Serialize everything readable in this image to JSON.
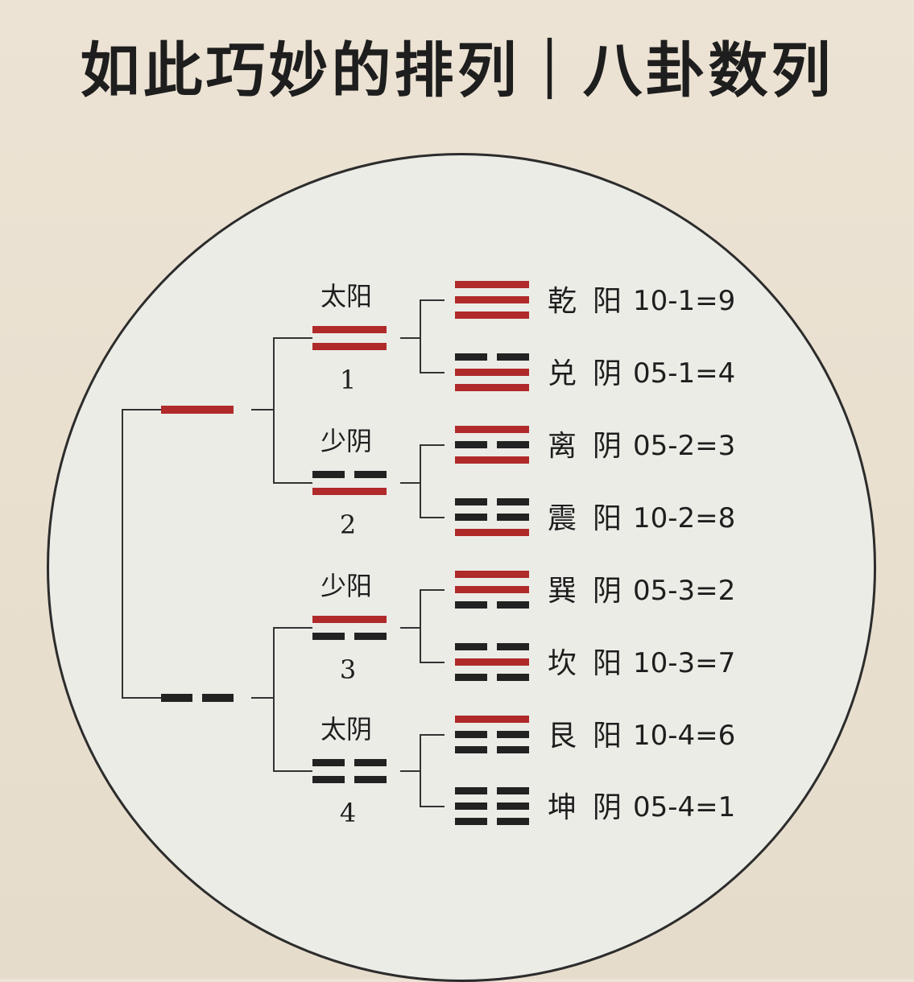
{
  "title": "如此巧妙的排列｜八卦数列",
  "colors": {
    "yang": "#b02a2a",
    "yin": "#222222",
    "bracket": "#333333"
  },
  "level1": [
    {
      "line": "yang"
    },
    {
      "line": "yin"
    }
  ],
  "level2": [
    {
      "name": "太阳",
      "num": "1",
      "lines": [
        "yang",
        "yang"
      ]
    },
    {
      "name": "少阴",
      "num": "2",
      "lines": [
        "yin",
        "yang"
      ]
    },
    {
      "name": "少阳",
      "num": "3",
      "lines": [
        "yang",
        "yin"
      ]
    },
    {
      "name": "太阴",
      "num": "4",
      "lines": [
        "yin",
        "yin"
      ]
    }
  ],
  "level3": [
    {
      "name": "乾",
      "polarity": "阳",
      "polarity_type": "yang",
      "formula": "10-1=9",
      "lines": [
        "yang",
        "yang",
        "yang"
      ]
    },
    {
      "name": "兑",
      "polarity": "阴",
      "polarity_type": "yin",
      "formula": "05-1=4",
      "lines": [
        "yin",
        "yang",
        "yang"
      ]
    },
    {
      "name": "离",
      "polarity": "阴",
      "polarity_type": "yin",
      "formula": "05-2=3",
      "lines": [
        "yang",
        "yin",
        "yang"
      ]
    },
    {
      "name": "震",
      "polarity": "阳",
      "polarity_type": "yang",
      "formula": "10-2=8",
      "lines": [
        "yin",
        "yin",
        "yang"
      ]
    },
    {
      "name": "巽",
      "polarity": "阴",
      "polarity_type": "yin",
      "formula": "05-3=2",
      "lines": [
        "yang",
        "yang",
        "yin"
      ]
    },
    {
      "name": "坎",
      "polarity": "阳",
      "polarity_type": "yang",
      "formula": "10-3=7",
      "lines": [
        "yin",
        "yang",
        "yin"
      ]
    },
    {
      "name": "艮",
      "polarity": "阳",
      "polarity_type": "yang",
      "formula": "10-4=6",
      "lines": [
        "yang",
        "yin",
        "yin"
      ]
    },
    {
      "name": "坤",
      "polarity": "阴",
      "polarity_type": "yin",
      "formula": "05-4=1",
      "lines": [
        "yin",
        "yin",
        "yin"
      ]
    }
  ]
}
